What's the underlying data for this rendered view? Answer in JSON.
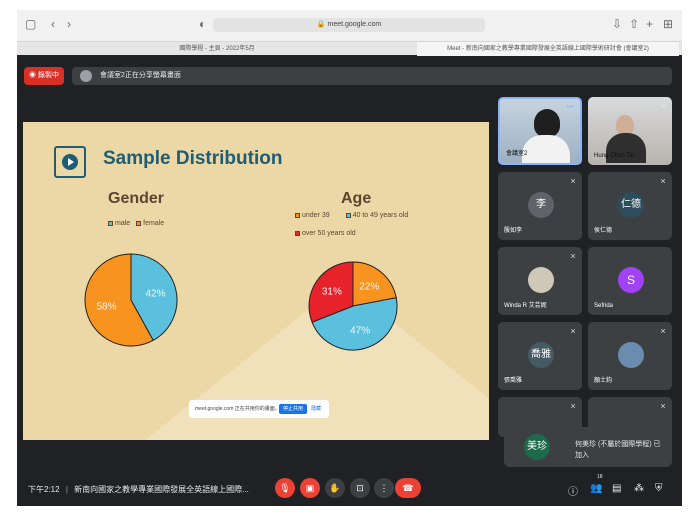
{
  "browser": {
    "url": "meet.google.com",
    "tabs": [
      {
        "label": "國際學程 - 主頁 - 2022年5月"
      },
      {
        "label": "Meet - 新南向國家之教學專業國際發展全英語線上國際學術研討會 (會議室2)"
      }
    ]
  },
  "meet": {
    "recording_label": "錄製中",
    "share_banner": "會議室2正在分享螢幕畫面",
    "time": "下午2:12",
    "meeting_title": "新南向國家之教學專業國際發展全英語線上國際...",
    "participant_count": "18"
  },
  "slide": {
    "title": "Sample Distribution"
  },
  "chart_data": [
    {
      "type": "pie",
      "title": "Gender",
      "legend": [
        "male",
        "female"
      ],
      "slices": [
        {
          "label": "male",
          "value": 42,
          "text": "42%",
          "color": "#5bc0de"
        },
        {
          "label": "female",
          "value": 58,
          "text": "58%",
          "color": "#f7931e"
        }
      ]
    },
    {
      "type": "pie",
      "title": "Age",
      "legend": [
        "under 39",
        "40 to 49 years old",
        "over 50 years old"
      ],
      "slices": [
        {
          "label": "under 39",
          "value": 22,
          "text": "22%",
          "color": "#f7931e"
        },
        {
          "label": "40 to 49 years old",
          "value": 47,
          "text": "47%",
          "color": "#5bc0de"
        },
        {
          "label": "over 50 years old",
          "value": 31,
          "text": "31%",
          "color": "#e8222a"
        }
      ]
    }
  ],
  "snackbar": {
    "text": "meet.google.com 正在共用你的畫面。",
    "stop_label": "停止共用",
    "hide_label": "隱藏"
  },
  "participants": [
    {
      "name": "會議室2",
      "avatar": "",
      "color": ""
    },
    {
      "name": "Hung-Chun Tai",
      "avatar": "",
      "color": ""
    },
    {
      "name": "殷如李",
      "avatar": "李",
      "color": "#5f6368"
    },
    {
      "name": "侯仁德",
      "avatar": "仁德",
      "color": "#2d4d5c"
    },
    {
      "name": "Winda R 艾芸妮",
      "avatar": "",
      "color": "#cfc8b6"
    },
    {
      "name": "Sefrida",
      "avatar": "S",
      "color": "#a142f4"
    },
    {
      "name": "張喬雅",
      "avatar": "喬雅",
      "color": "#455a64"
    },
    {
      "name": "顏士鈞",
      "avatar": "",
      "color": "#6a8caf"
    }
  ],
  "notification": {
    "avatar": "美珍",
    "text": "何美珍 (不屬於國際學程) 已加入"
  }
}
